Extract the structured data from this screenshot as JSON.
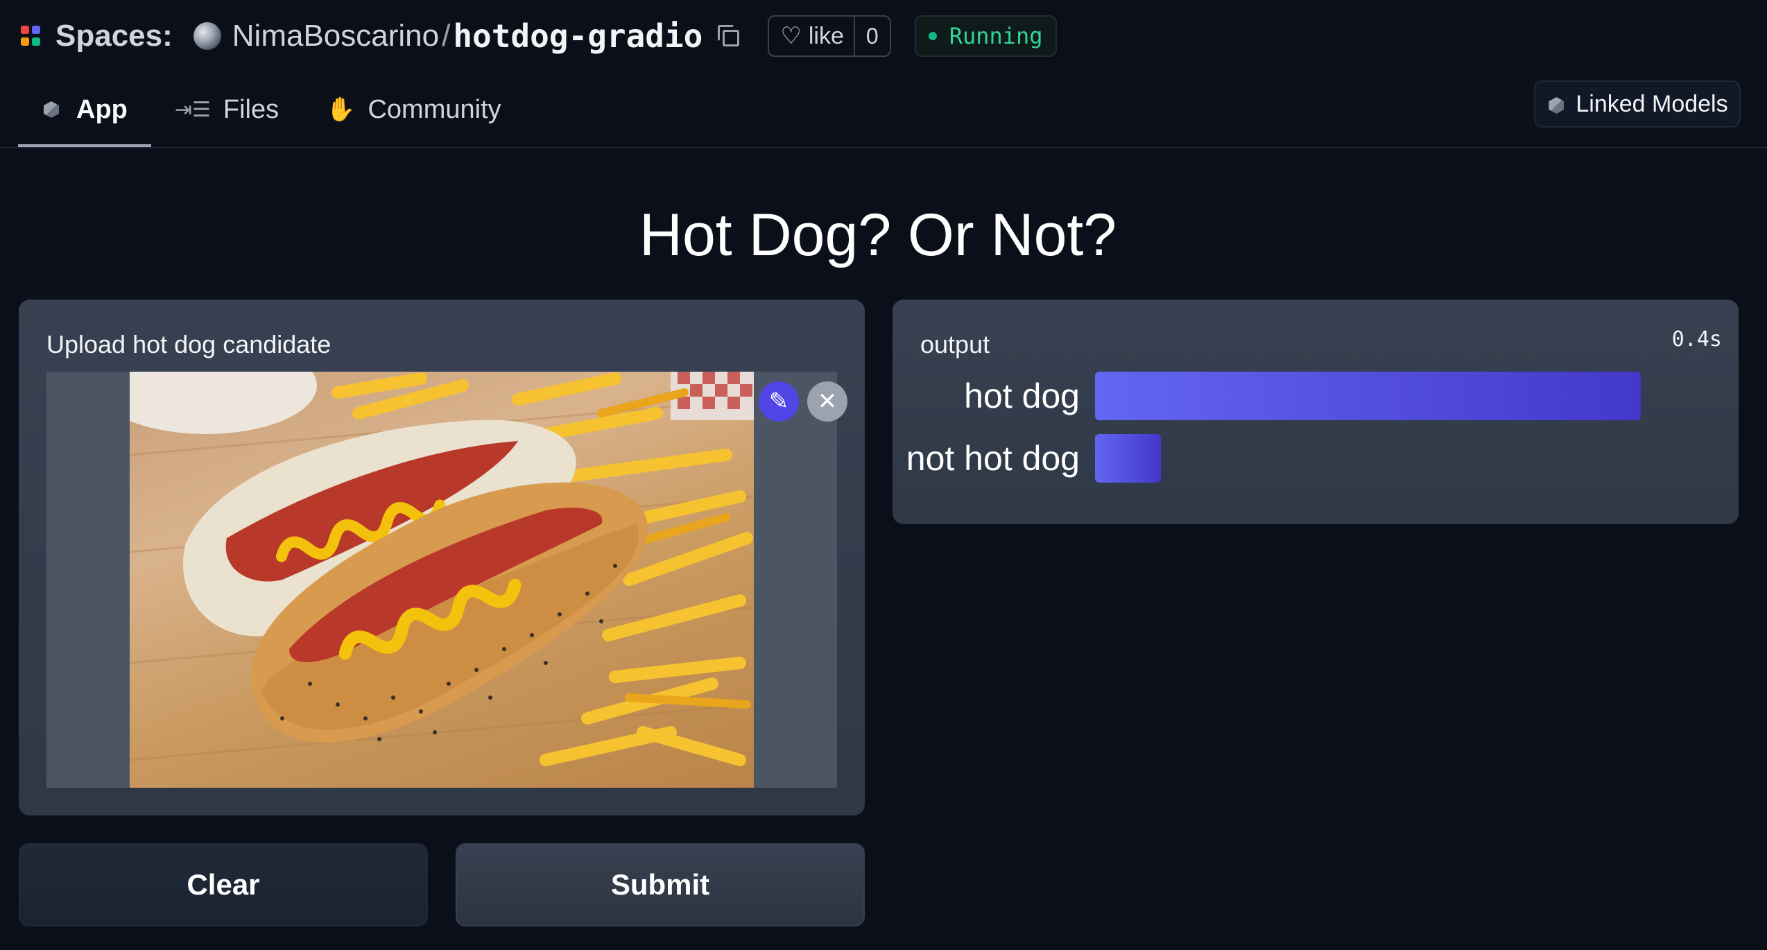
{
  "header": {
    "spaces_label": "Spaces:",
    "owner": "NimaBoscarino",
    "separator": "/",
    "repo": "hotdog-gradio",
    "like_label": "like",
    "like_count": "0",
    "status": "Running"
  },
  "tabs": [
    {
      "label": "App",
      "icon": "cube-icon",
      "active": true
    },
    {
      "label": "Files",
      "icon": "files-icon",
      "active": false
    },
    {
      "label": "Community",
      "icon": "community-icon",
      "active": false
    }
  ],
  "linked_models_label": "Linked Models",
  "main": {
    "title": "Hot Dog? Or Not?",
    "input": {
      "label": "Upload hot dog candidate",
      "edit_icon": "✎",
      "remove_icon": "✕"
    },
    "output": {
      "label": "output",
      "timing": "0.4s",
      "results": [
        {
          "label": "hot dog",
          "confidence": 0.99
        },
        {
          "label": "not hot dog",
          "confidence": 0.12
        }
      ]
    }
  },
  "actions": {
    "clear_label": "Clear",
    "submit_label": "Submit"
  },
  "colors": {
    "background": "#0b0f19",
    "panel": "#374151",
    "accent": "#4f46e5",
    "status_green": "#10b981"
  }
}
